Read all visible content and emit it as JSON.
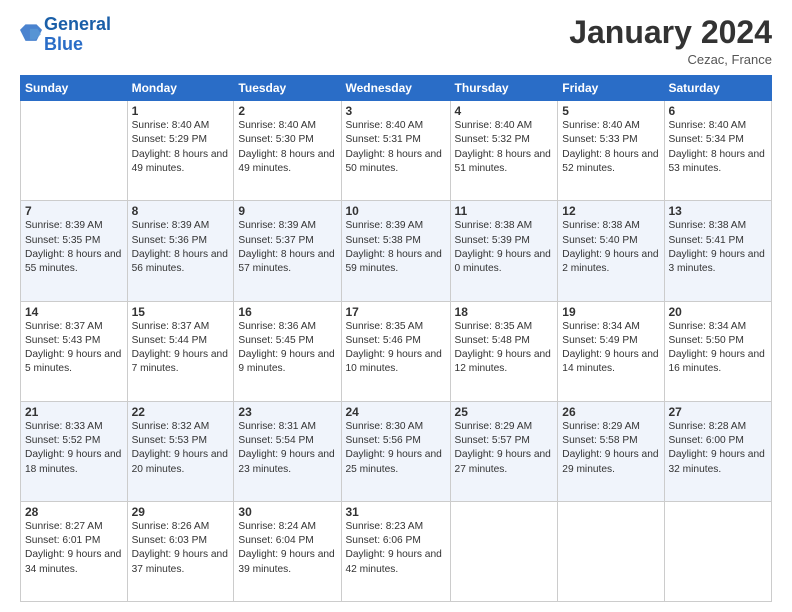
{
  "logo": {
    "text_general": "General",
    "text_blue": "Blue"
  },
  "header": {
    "month": "January 2024",
    "location": "Cezac, France"
  },
  "weekdays": [
    "Sunday",
    "Monday",
    "Tuesday",
    "Wednesday",
    "Thursday",
    "Friday",
    "Saturday"
  ],
  "weeks": [
    [
      {
        "day": "",
        "sunrise": "",
        "sunset": "",
        "daylight": ""
      },
      {
        "day": "1",
        "sunrise": "Sunrise: 8:40 AM",
        "sunset": "Sunset: 5:29 PM",
        "daylight": "Daylight: 8 hours and 49 minutes."
      },
      {
        "day": "2",
        "sunrise": "Sunrise: 8:40 AM",
        "sunset": "Sunset: 5:30 PM",
        "daylight": "Daylight: 8 hours and 49 minutes."
      },
      {
        "day": "3",
        "sunrise": "Sunrise: 8:40 AM",
        "sunset": "Sunset: 5:31 PM",
        "daylight": "Daylight: 8 hours and 50 minutes."
      },
      {
        "day": "4",
        "sunrise": "Sunrise: 8:40 AM",
        "sunset": "Sunset: 5:32 PM",
        "daylight": "Daylight: 8 hours and 51 minutes."
      },
      {
        "day": "5",
        "sunrise": "Sunrise: 8:40 AM",
        "sunset": "Sunset: 5:33 PM",
        "daylight": "Daylight: 8 hours and 52 minutes."
      },
      {
        "day": "6",
        "sunrise": "Sunrise: 8:40 AM",
        "sunset": "Sunset: 5:34 PM",
        "daylight": "Daylight: 8 hours and 53 minutes."
      }
    ],
    [
      {
        "day": "7",
        "sunrise": "Sunrise: 8:39 AM",
        "sunset": "Sunset: 5:35 PM",
        "daylight": "Daylight: 8 hours and 55 minutes."
      },
      {
        "day": "8",
        "sunrise": "Sunrise: 8:39 AM",
        "sunset": "Sunset: 5:36 PM",
        "daylight": "Daylight: 8 hours and 56 minutes."
      },
      {
        "day": "9",
        "sunrise": "Sunrise: 8:39 AM",
        "sunset": "Sunset: 5:37 PM",
        "daylight": "Daylight: 8 hours and 57 minutes."
      },
      {
        "day": "10",
        "sunrise": "Sunrise: 8:39 AM",
        "sunset": "Sunset: 5:38 PM",
        "daylight": "Daylight: 8 hours and 59 minutes."
      },
      {
        "day": "11",
        "sunrise": "Sunrise: 8:38 AM",
        "sunset": "Sunset: 5:39 PM",
        "daylight": "Daylight: 9 hours and 0 minutes."
      },
      {
        "day": "12",
        "sunrise": "Sunrise: 8:38 AM",
        "sunset": "Sunset: 5:40 PM",
        "daylight": "Daylight: 9 hours and 2 minutes."
      },
      {
        "day": "13",
        "sunrise": "Sunrise: 8:38 AM",
        "sunset": "Sunset: 5:41 PM",
        "daylight": "Daylight: 9 hours and 3 minutes."
      }
    ],
    [
      {
        "day": "14",
        "sunrise": "Sunrise: 8:37 AM",
        "sunset": "Sunset: 5:43 PM",
        "daylight": "Daylight: 9 hours and 5 minutes."
      },
      {
        "day": "15",
        "sunrise": "Sunrise: 8:37 AM",
        "sunset": "Sunset: 5:44 PM",
        "daylight": "Daylight: 9 hours and 7 minutes."
      },
      {
        "day": "16",
        "sunrise": "Sunrise: 8:36 AM",
        "sunset": "Sunset: 5:45 PM",
        "daylight": "Daylight: 9 hours and 9 minutes."
      },
      {
        "day": "17",
        "sunrise": "Sunrise: 8:35 AM",
        "sunset": "Sunset: 5:46 PM",
        "daylight": "Daylight: 9 hours and 10 minutes."
      },
      {
        "day": "18",
        "sunrise": "Sunrise: 8:35 AM",
        "sunset": "Sunset: 5:48 PM",
        "daylight": "Daylight: 9 hours and 12 minutes."
      },
      {
        "day": "19",
        "sunrise": "Sunrise: 8:34 AM",
        "sunset": "Sunset: 5:49 PM",
        "daylight": "Daylight: 9 hours and 14 minutes."
      },
      {
        "day": "20",
        "sunrise": "Sunrise: 8:34 AM",
        "sunset": "Sunset: 5:50 PM",
        "daylight": "Daylight: 9 hours and 16 minutes."
      }
    ],
    [
      {
        "day": "21",
        "sunrise": "Sunrise: 8:33 AM",
        "sunset": "Sunset: 5:52 PM",
        "daylight": "Daylight: 9 hours and 18 minutes."
      },
      {
        "day": "22",
        "sunrise": "Sunrise: 8:32 AM",
        "sunset": "Sunset: 5:53 PM",
        "daylight": "Daylight: 9 hours and 20 minutes."
      },
      {
        "day": "23",
        "sunrise": "Sunrise: 8:31 AM",
        "sunset": "Sunset: 5:54 PM",
        "daylight": "Daylight: 9 hours and 23 minutes."
      },
      {
        "day": "24",
        "sunrise": "Sunrise: 8:30 AM",
        "sunset": "Sunset: 5:56 PM",
        "daylight": "Daylight: 9 hours and 25 minutes."
      },
      {
        "day": "25",
        "sunrise": "Sunrise: 8:29 AM",
        "sunset": "Sunset: 5:57 PM",
        "daylight": "Daylight: 9 hours and 27 minutes."
      },
      {
        "day": "26",
        "sunrise": "Sunrise: 8:29 AM",
        "sunset": "Sunset: 5:58 PM",
        "daylight": "Daylight: 9 hours and 29 minutes."
      },
      {
        "day": "27",
        "sunrise": "Sunrise: 8:28 AM",
        "sunset": "Sunset: 6:00 PM",
        "daylight": "Daylight: 9 hours and 32 minutes."
      }
    ],
    [
      {
        "day": "28",
        "sunrise": "Sunrise: 8:27 AM",
        "sunset": "Sunset: 6:01 PM",
        "daylight": "Daylight: 9 hours and 34 minutes."
      },
      {
        "day": "29",
        "sunrise": "Sunrise: 8:26 AM",
        "sunset": "Sunset: 6:03 PM",
        "daylight": "Daylight: 9 hours and 37 minutes."
      },
      {
        "day": "30",
        "sunrise": "Sunrise: 8:24 AM",
        "sunset": "Sunset: 6:04 PM",
        "daylight": "Daylight: 9 hours and 39 minutes."
      },
      {
        "day": "31",
        "sunrise": "Sunrise: 8:23 AM",
        "sunset": "Sunset: 6:06 PM",
        "daylight": "Daylight: 9 hours and 42 minutes."
      },
      {
        "day": "",
        "sunrise": "",
        "sunset": "",
        "daylight": ""
      },
      {
        "day": "",
        "sunrise": "",
        "sunset": "",
        "daylight": ""
      },
      {
        "day": "",
        "sunrise": "",
        "sunset": "",
        "daylight": ""
      }
    ]
  ]
}
